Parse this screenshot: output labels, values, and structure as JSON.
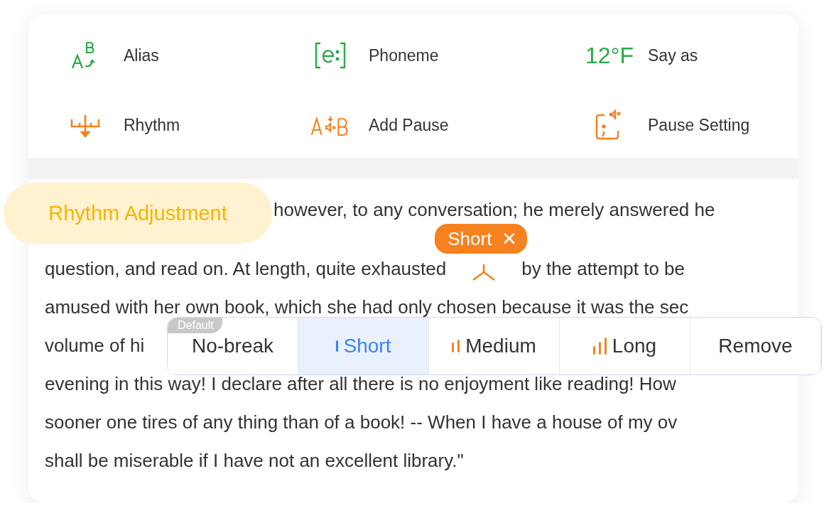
{
  "tools": [
    {
      "label": "Alias",
      "kind": "alias",
      "color": "#2aa84a"
    },
    {
      "label": "Phoneme",
      "kind": "phoneme",
      "color": "#2aa84a"
    },
    {
      "label": "Say as",
      "kind": "sayas",
      "color": "#2aa84a",
      "icon_text": "12°F"
    },
    {
      "label": "Rhythm",
      "kind": "rhythm",
      "color": "#f5821f"
    },
    {
      "label": "Add Pause",
      "kind": "addpause",
      "color": "#f5821f"
    },
    {
      "label": "Pause Setting",
      "kind": "pausesetting",
      "color": "#f5821f"
    }
  ],
  "rhythm_tag": {
    "label": "Rhythm Adjustment"
  },
  "lines": [
    {
      "kind": "indented",
      "text": "however, to any conversation; he merely answered he"
    },
    {
      "kind": "marker",
      "text": "question, and read on. At length, quite exhausted",
      "after": "by the attempt to be",
      "marker": {
        "label": "Short",
        "close": "✕"
      }
    },
    {
      "kind": "plain",
      "text": "amused with her own book, which she had only chosen because it was the sec"
    },
    {
      "kind": "plain",
      "text": "volume of hi"
    },
    {
      "kind": "plain",
      "text": "evening in this way! I declare after all there is no enjoyment like reading! How"
    },
    {
      "kind": "plain",
      "text": "sooner one tires of any thing than of a book! -- When I have a house of my ov"
    },
    {
      "kind": "plain",
      "text": "shall be miserable if I have not an excellent library.\""
    }
  ],
  "pause_menu": {
    "badge": "Default",
    "options": [
      {
        "label": "No-break",
        "kind": "plain",
        "selected": false
      },
      {
        "label": "Short",
        "kind": "short",
        "selected": true
      },
      {
        "label": "Medium",
        "kind": "medium",
        "selected": false
      },
      {
        "label": "Long",
        "kind": "long",
        "selected": false
      },
      {
        "label": "Remove",
        "kind": "plain",
        "selected": false
      }
    ]
  }
}
